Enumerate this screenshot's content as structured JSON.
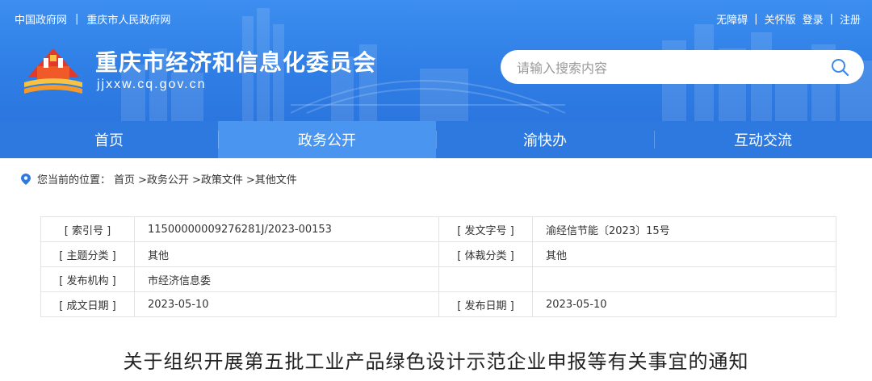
{
  "top_links": {
    "gov_site": "中国政府网",
    "separator": "|",
    "cq_gov_site": "重庆市人民政府网"
  },
  "top_right": {
    "accessible": "无障碍",
    "sep1": "|",
    "care_version": "关怀版",
    "login": "登录",
    "sep2": "|",
    "register": "注册"
  },
  "site": {
    "title": "重庆市经济和信息化委员会",
    "domain": "jjxxw.cq.gov.cn"
  },
  "search": {
    "placeholder": "请输入搜索内容",
    "icon": "search-icon"
  },
  "nav": {
    "items": [
      {
        "label": "首页"
      },
      {
        "label": "政务公开"
      },
      {
        "label": "渝快办"
      },
      {
        "label": "互动交流"
      }
    ],
    "active_index": 1
  },
  "breadcrumb": {
    "prefix": "您当前的位置：",
    "items": [
      "首页",
      ">政务公开",
      ">政策文件",
      ">其他文件"
    ]
  },
  "meta": {
    "rows": [
      {
        "k1": "[ 索引号 ]",
        "v1": "11500000009276281J/2023-00153",
        "k2": "[ 发文字号 ]",
        "v2": "渝经信节能〔2023〕15号"
      },
      {
        "k1": "[ 主题分类 ]",
        "v1": "其他",
        "k2": "[ 体裁分类 ]",
        "v2": "其他"
      },
      {
        "k1": "[ 发布机构 ]",
        "v1": "市经济信息委",
        "k2": "",
        "v2": ""
      },
      {
        "k1": "[ 成文日期 ]",
        "v1": "2023-05-10",
        "k2": "[ 发布日期 ]",
        "v2": "2023-05-10"
      }
    ]
  },
  "document": {
    "title": "关于组织开展第五批工业产品绿色设计示范企业申报等有关事宜的通知"
  },
  "colors": {
    "header_blue": "#2f7fe6",
    "nav_blue": "#2d79df",
    "nav_active": "#4a95f0"
  }
}
